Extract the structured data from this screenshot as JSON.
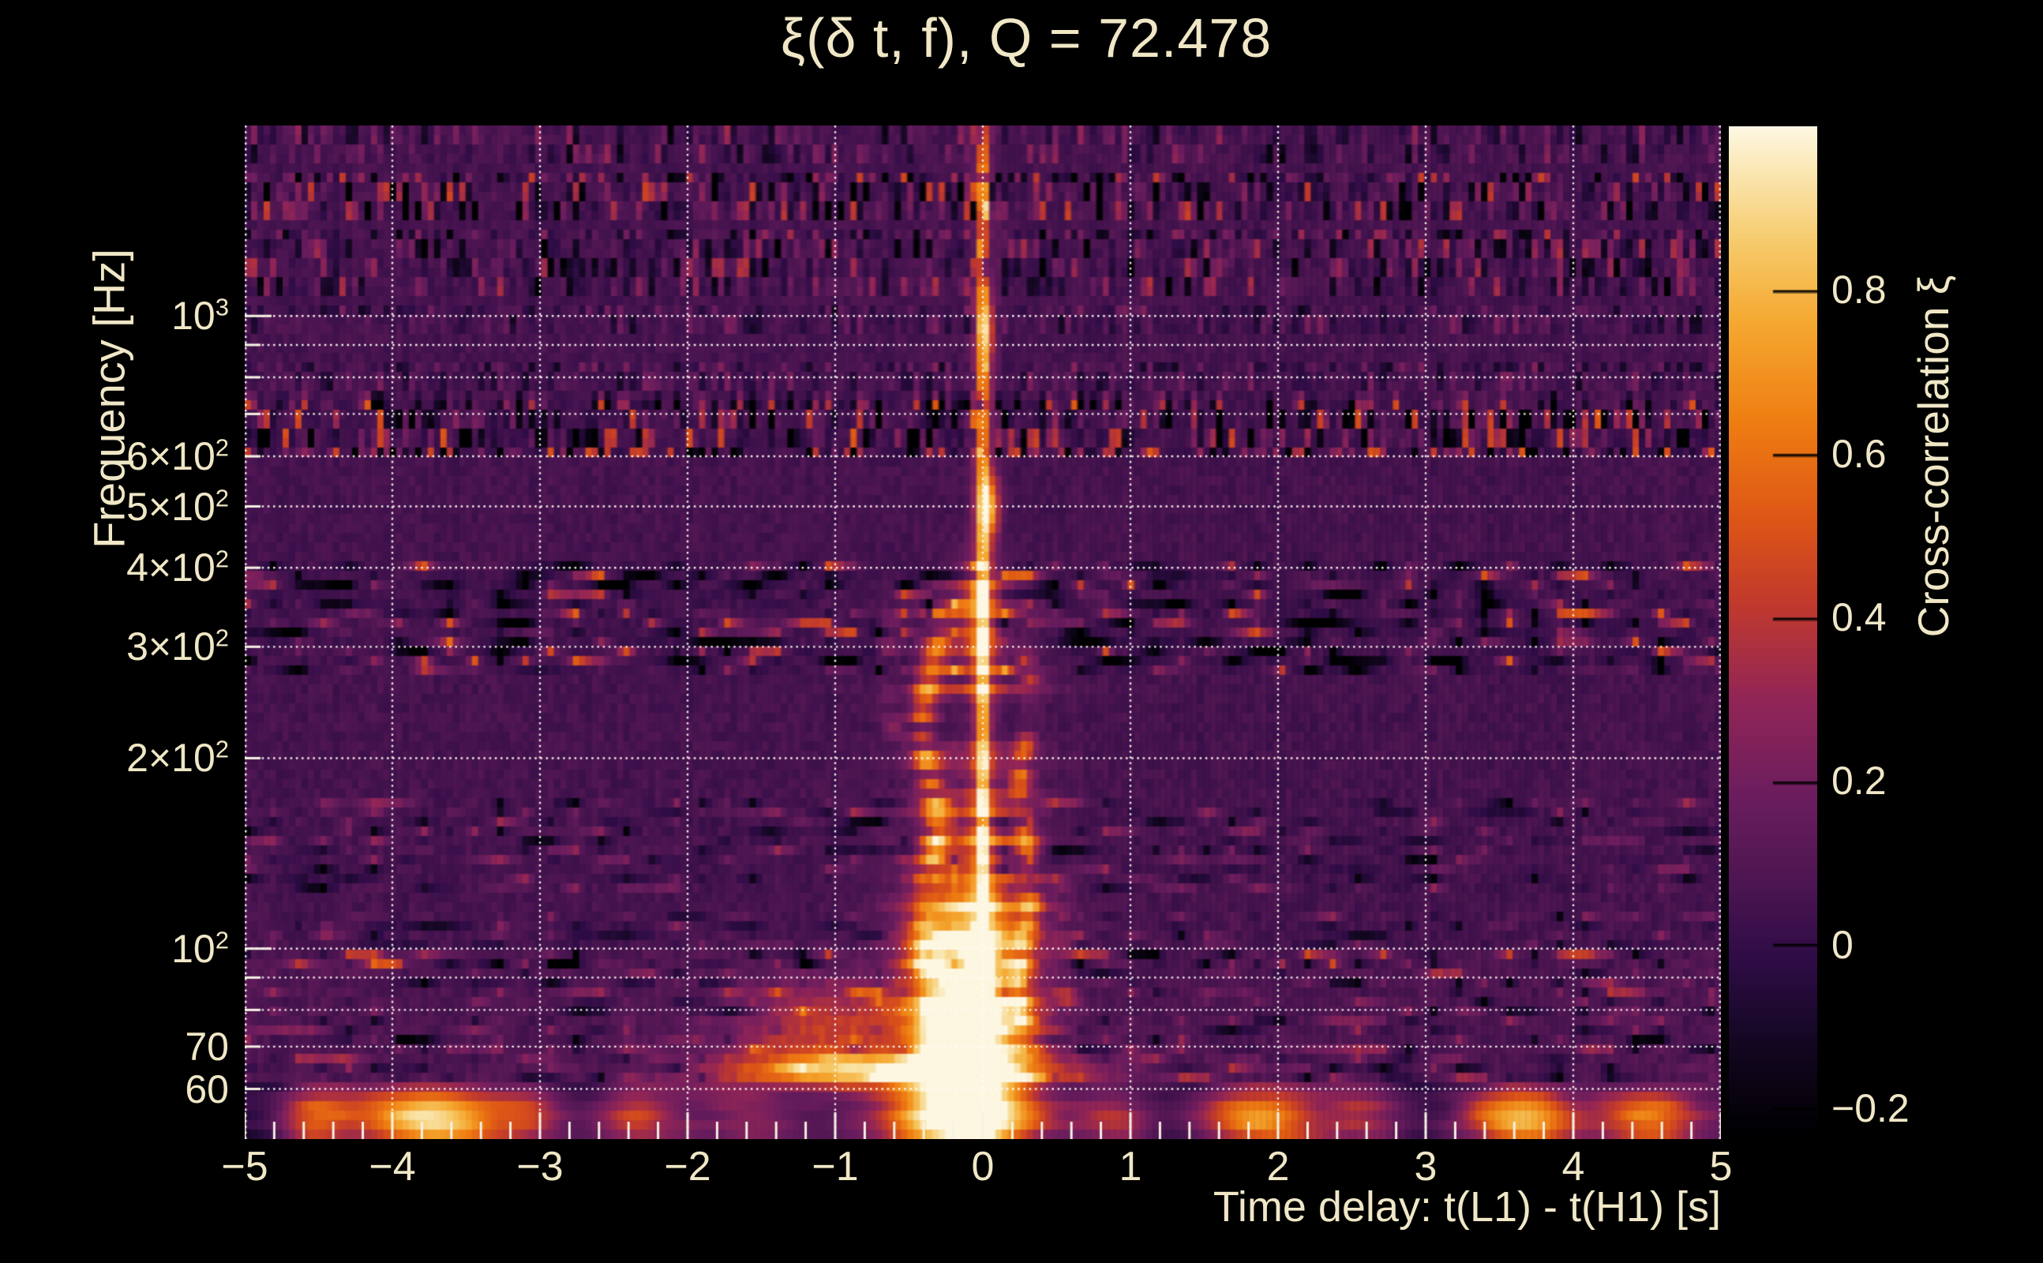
{
  "chart_data": {
    "type": "heatmap",
    "title": "ξ(δ t, f), Q = 72.478",
    "q_value": 72.478,
    "xlabel": "Time delay: t(L1) - t(H1) [s]",
    "ylabel": "Frequency [Hz]",
    "colorbar_label": "Cross-correlation ξ",
    "x_range": [
      -5,
      5
    ],
    "freq_range_hz": [
      50,
      2000
    ],
    "freq_scale": "log",
    "value_range": [
      -0.232,
      1.0
    ],
    "grid": "on",
    "x_gridlines": [
      -5,
      -4,
      -3,
      -2,
      -1,
      0,
      1,
      2,
      3,
      4,
      5
    ],
    "freq_gridlines_hz": [
      60,
      70,
      80,
      90,
      100,
      200,
      300,
      400,
      500,
      600,
      700,
      800,
      900,
      1000
    ],
    "x_minor_tick_step": 0.2,
    "x_ticks": [
      {
        "v": -5,
        "label": "−5"
      },
      {
        "v": -4,
        "label": "−4"
      },
      {
        "v": -3,
        "label": "−3"
      },
      {
        "v": -2,
        "label": "−2"
      },
      {
        "v": -1,
        "label": "−1"
      },
      {
        "v": 0,
        "label": "0"
      },
      {
        "v": 1,
        "label": "1"
      },
      {
        "v": 2,
        "label": "2"
      },
      {
        "v": 3,
        "label": "3"
      },
      {
        "v": 4,
        "label": "4"
      },
      {
        "v": 5,
        "label": "5"
      }
    ],
    "freq_ticks": [
      {
        "v": 1000,
        "mant": "10",
        "exp": "3"
      },
      {
        "v": 600,
        "mant": "6×10",
        "exp": "2"
      },
      {
        "v": 500,
        "mant": "5×10",
        "exp": "2"
      },
      {
        "v": 400,
        "mant": "4×10",
        "exp": "2"
      },
      {
        "v": 300,
        "mant": "3×10",
        "exp": "2"
      },
      {
        "v": 200,
        "mant": "2×10",
        "exp": "2"
      },
      {
        "v": 100,
        "mant": "10",
        "exp": "2"
      },
      {
        "v": 70,
        "mant": "70",
        "exp": ""
      },
      {
        "v": 60,
        "mant": "60",
        "exp": ""
      }
    ],
    "colorbar_ticks": [
      {
        "v": 0.8,
        "label": "0.8"
      },
      {
        "v": 0.6,
        "label": "0.6"
      },
      {
        "v": 0.4,
        "label": "0.4"
      },
      {
        "v": 0.2,
        "label": "0.2"
      },
      {
        "v": 0,
        "label": "0"
      },
      {
        "v": -0.2,
        "label": "−0.2"
      }
    ],
    "palette": [
      [
        -0.232,
        "#000002"
      ],
      [
        -0.12,
        "#140722"
      ],
      [
        -0.02,
        "#2e0c45"
      ],
      [
        0.08,
        "#4e1652"
      ],
      [
        0.18,
        "#6b1d5e"
      ],
      [
        0.3,
        "#922556"
      ],
      [
        0.42,
        "#c23a2c"
      ],
      [
        0.52,
        "#dd5616"
      ],
      [
        0.64,
        "#ef7e12"
      ],
      [
        0.76,
        "#f5a830"
      ],
      [
        0.86,
        "#f6cb6c"
      ],
      [
        0.94,
        "#fae5ae"
      ],
      [
        1.0,
        "#fdf7e2"
      ]
    ],
    "background": {
      "base": 0.055,
      "noise": 0.07
    },
    "noise_bands": [
      {
        "f": [
          1760,
          1990
        ],
        "amp": 0.1,
        "style": "v",
        "bias": 0
      },
      {
        "f": [
          1420,
          1660
        ],
        "amp": 0.16,
        "style": "v",
        "bias": 0
      },
      {
        "f": [
          1090,
          1390
        ],
        "amp": 0.13,
        "style": "v",
        "bias": 0
      },
      {
        "f": [
          945,
          1045
        ],
        "amp": 0.07,
        "style": "v",
        "bias": 0
      },
      {
        "f": [
          735,
          835
        ],
        "amp": 0.08,
        "style": "v",
        "bias": 0
      },
      {
        "f": [
          595,
          735
        ],
        "amp": 0.2,
        "style": "v",
        "bias": -0.01
      },
      {
        "f": [
          268,
          408
        ],
        "amp": 0.21,
        "style": "h",
        "bias": -0.01
      },
      {
        "f": [
          122,
          172
        ],
        "amp": 0.11,
        "style": "h",
        "bias": 0
      },
      {
        "f": [
          92,
          116
        ],
        "amp": 0.09,
        "style": "h",
        "bias": 0
      },
      {
        "f": [
          61,
          100
        ],
        "amp": 0.12,
        "style": "h",
        "bias": 0.025
      }
    ],
    "chirp": {
      "line": {
        "t": 0,
        "sigma": 0.013,
        "amp_high_f": 0.72,
        "amp_low_f": 1.08,
        "glow_sigma": 0.05,
        "glow_amp_low": 0.4,
        "glow_amp_high": 0.22
      },
      "knots": [
        {
          "f": 500,
          "t": 0.05,
          "st": 0.05,
          "sf": 0.035,
          "amp": 0.55
        },
        {
          "f": 950,
          "t": 0.03,
          "st": 0.04,
          "sf": 0.03,
          "amp": 0.3
        },
        {
          "f": 1600,
          "t": 0.0,
          "st": 0.03,
          "sf": 0.03,
          "amp": 0.28
        },
        {
          "f": 330,
          "t": -0.05,
          "st": 0.12,
          "sf": 0.06,
          "amp": 0.35
        }
      ],
      "side_stripes": [
        {
          "t": -0.36,
          "sigma": 0.065,
          "f": [
            64,
            345
          ],
          "amp": 0.62,
          "wobble": 0.05,
          "dropout": 0.35
        },
        {
          "t": 0.29,
          "sigma": 0.055,
          "f": [
            64,
            300
          ],
          "amp": 0.5,
          "wobble": 0.04,
          "dropout": 0.4
        },
        {
          "t": -0.62,
          "sigma": 0.05,
          "f": [
            215,
            335
          ],
          "amp": 0.22,
          "wobble": 0.03,
          "dropout": 0.5
        },
        {
          "t": 0.55,
          "sigma": 0.05,
          "f": [
            80,
            140
          ],
          "amp": 0.28,
          "wobble": 0.03,
          "dropout": 0.5
        }
      ],
      "halo": {
        "f": [
          62,
          380
        ],
        "t_center": -0.05,
        "sigma": 0.33,
        "amp_max": 0.38,
        "low_f_boost_below_hz": 130
      },
      "blob": {
        "t": -0.1,
        "t_sigma": 0.27,
        "f": 80,
        "logf_sigma": 0.16,
        "amp": 1.0
      },
      "low_streak": {
        "f": 64,
        "logf_sigma": 0.02,
        "t": -0.6,
        "t_sigma": 0.8,
        "amp": 0.75
      },
      "wing": {
        "f": 75,
        "logf_sigma": 0.05,
        "t": -1.05,
        "t_sigma": 0.45,
        "amp": 0.35
      }
    },
    "bottom_band": {
      "f_max": 61,
      "f_blob_center": 54,
      "blobs": [
        {
          "t": -4.55,
          "w": 0.18,
          "amp": 0.5
        },
        {
          "t": -3.75,
          "w": 0.35,
          "amp": 0.85
        },
        {
          "t": -3.05,
          "w": 0.2,
          "amp": 0.4
        },
        {
          "t": -2.35,
          "w": 0.2,
          "amp": 0.45
        },
        {
          "t": -1.55,
          "w": 0.25,
          "amp": 0.28
        },
        {
          "t": -0.15,
          "w": 0.45,
          "amp": 0.8
        },
        {
          "t": 0.9,
          "w": 0.2,
          "amp": 0.35
        },
        {
          "t": 1.85,
          "w": 0.3,
          "amp": 0.7
        },
        {
          "t": 2.6,
          "w": 0.2,
          "amp": 0.3
        },
        {
          "t": 3.65,
          "w": 0.3,
          "amp": 0.8
        },
        {
          "t": 4.5,
          "w": 0.25,
          "amp": 0.6
        }
      ],
      "dark_patches": [
        {
          "t": -4.9,
          "w": 0.3
        },
        {
          "t": -2.8,
          "w": 0.3
        },
        {
          "t": -1.0,
          "w": 0.5
        },
        {
          "t": 0.45,
          "w": 0.3
        },
        {
          "t": 1.3,
          "w": 0.35
        },
        {
          "t": 3.1,
          "w": 0.3
        },
        {
          "t": 4.1,
          "w": 0.25
        }
      ]
    },
    "text_color": "#f0e7c6",
    "gridline_color": "#fffcf4",
    "tick_color": "#f6f2e4",
    "colorbar_tick_color": "#000000"
  }
}
